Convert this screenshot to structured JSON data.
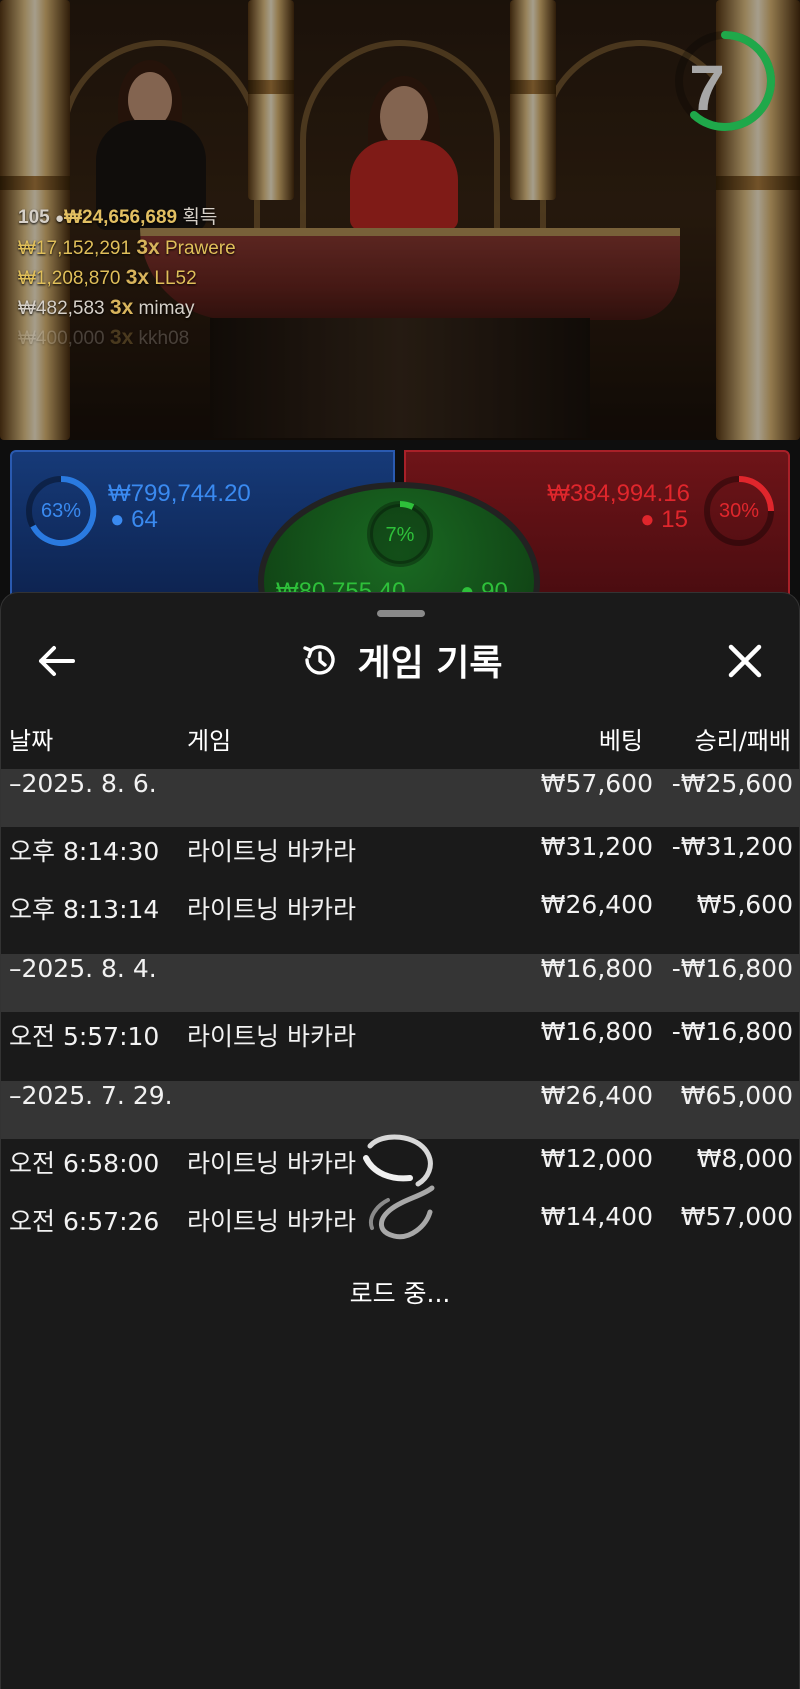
{
  "game_view": {
    "timer_value": "7",
    "winners": {
      "player_count": "105",
      "total_amount": "₩24,656,689",
      "total_suffix": "획득",
      "list": [
        {
          "amount": "₩17,152,291",
          "multiplier": "3x",
          "name": "Prawere"
        },
        {
          "amount": "₩1,208,870",
          "multiplier": "3x",
          "name": "LL52"
        },
        {
          "amount": "₩482,583",
          "multiplier": "3x",
          "name": "mimay"
        },
        {
          "amount": "₩400,000",
          "multiplier": "3x",
          "name": "kkh08"
        }
      ]
    },
    "player_bet": {
      "percent": "63%",
      "amount": "₩799,744.20",
      "players": "64",
      "color": "#2a6fd6"
    },
    "banker_bet": {
      "percent": "30%",
      "amount": "₩384,994.16",
      "players": "15",
      "color": "#d6262c"
    },
    "tie_bet": {
      "percent": "7%",
      "amount": "₩80,755.40",
      "players": "90",
      "color": "#2ec03a"
    }
  },
  "history": {
    "title": "게임 기록",
    "columns": {
      "date": "날짜",
      "game": "게임",
      "bet": "베팅",
      "win_loss": "승리/패배"
    },
    "groups": [
      {
        "date": "–2025. 8. 6.",
        "bet": "₩57,600",
        "win_loss": "-₩25,600",
        "rows": [
          {
            "time": "오후 8:14:30",
            "game": "라이트닝 바카라",
            "bet": "₩31,200",
            "win_loss": "-₩31,200"
          },
          {
            "time": "오후 8:13:14",
            "game": "라이트닝 바카라",
            "bet": "₩26,400",
            "win_loss": "₩5,600"
          }
        ]
      },
      {
        "date": "–2025. 8. 4.",
        "bet": "₩16,800",
        "win_loss": "-₩16,800",
        "rows": [
          {
            "time": "오전 5:57:10",
            "game": "라이트닝 바카라",
            "bet": "₩16,800",
            "win_loss": "-₩16,800"
          }
        ]
      },
      {
        "date": "–2025. 7. 29.",
        "bet": "₩26,400",
        "win_loss": "₩65,000",
        "rows": [
          {
            "time": "오전 6:58:00",
            "game": "라이트닝 바카라",
            "bet": "₩12,000",
            "win_loss": "₩8,000"
          },
          {
            "time": "오전 6:57:26",
            "game": "라이트닝 바카라",
            "bet": "₩14,400",
            "win_loss": "₩57,000"
          }
        ]
      }
    ],
    "loading_text": "로드 중..."
  },
  "icons": {
    "back": "arrow-left-icon",
    "history": "history-clock-icon",
    "close": "close-icon",
    "spinner": "loading-spinner-icon"
  }
}
